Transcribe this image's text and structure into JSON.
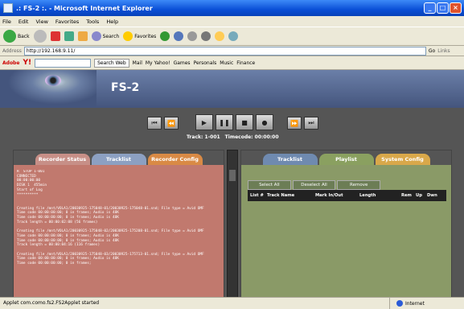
{
  "window": {
    "title": ".: FS-2 :. - Microsoft Internet Explorer"
  },
  "menu": [
    "File",
    "Edit",
    "View",
    "Favorites",
    "Tools",
    "Help"
  ],
  "toolbar": {
    "back": "Back",
    "search": "Search",
    "favorites": "Favorites"
  },
  "address": {
    "label": "Address",
    "url": "http://192.168.9.11/",
    "go": "Go",
    "links": "Links"
  },
  "yahoo": {
    "brand": "Adobe",
    "search_button": "Search Web",
    "items": [
      "Mail",
      "My Yahoo!",
      "Games",
      "Personals",
      "Music",
      "Finance"
    ]
  },
  "app": {
    "title": "FS-2",
    "track_label": "Track: 1-001",
    "timecode_label": "Timecode: 00:00:00"
  },
  "left_panel": {
    "tabs": [
      "Recorder Status",
      "Tracklist",
      "Recorder Config"
    ],
    "log_lines": [
      "R  STOP 1-001",
      "CONNECTED",
      "00:00:00:00",
      "DISK 1  455min",
      "Start of Log",
      "**********",
      "",
      "",
      "Creating file /mnt/VOLA1/20030925-175048-01/20030925-175048-01.snd; File type = Avid OMF",
      "Time code 00:00:00:00; 0 in frames; Audio is 48K",
      "Time code 00:00:00:00; 0 in frames; Audio is 48K",
      "Track length = 00:00:02:08 (56 frames)",
      "",
      "Creating file /mnt/VOLA1/20030925-175048-02/20030925-175208-01.snd; File type = Avid OMF",
      "Time code 00:00:00:00; 0 in frames; Audio is 48K",
      "Time code 00:00:00:00; 0 in frames; Audio is 48K",
      "Track length = 00:00:04:16 (116 frames)",
      "",
      "Creating file /mnt/VOLA1/20030925-175048-03/20030925-175713-01.snd; File type = Avid OMF",
      "Time code 00:00:00:00; 0 in frames; Audio is 48K",
      "Time code 00:00:00:00; 0 in frames;"
    ]
  },
  "right_panel": {
    "tabs": [
      "Tracklist",
      "Playlist",
      "System Config"
    ],
    "buttons": [
      "Select All",
      "Deselect All",
      "Remove"
    ],
    "columns": [
      "List #",
      "Track Name",
      "Mark In/Out",
      "Length",
      "Rem",
      "Up",
      "Dwn"
    ]
  },
  "status": {
    "text": "Applet com.como.fs2.FS2Applet started",
    "zone": "Internet"
  },
  "colors": {
    "recorder_tab": "#c78f87",
    "tracklist_tab": "#8ca0c2",
    "config_tab": "#d98a45",
    "playlist_tab": "#8aa060",
    "sysconfig_tab": "#d9a84a"
  }
}
